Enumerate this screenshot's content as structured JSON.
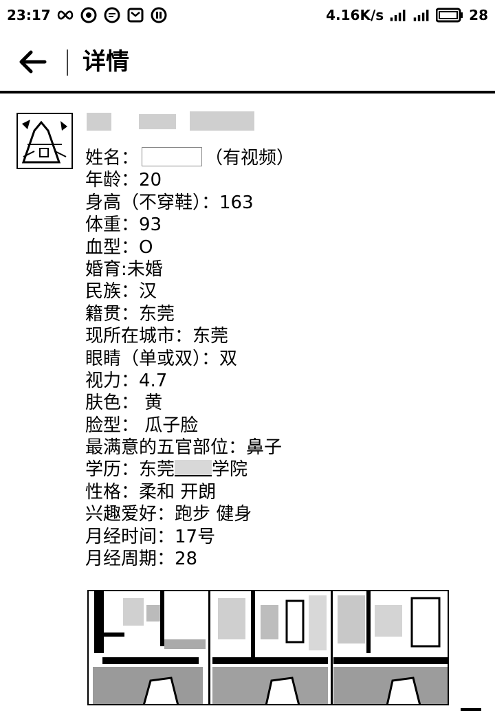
{
  "status_bar": {
    "time": "23:17",
    "network_speed": "4.16K/s",
    "battery": "28",
    "icons": [
      "infinity-icon",
      "sync-icon",
      "chat-icon",
      "mail-icon",
      "pause-icon",
      "hd-signal-icon",
      "signal-icon",
      "battery-icon"
    ]
  },
  "header": {
    "title": "详情",
    "back_icon": "arrow-left-icon"
  },
  "profile": {
    "lines": [
      {
        "label": "姓名：",
        "value": "（有视频）"
      },
      {
        "text": "年龄：20"
      },
      {
        "text": "身高（不穿鞋）：163"
      },
      {
        "text": "体重：93"
      },
      {
        "text": "血型：O"
      },
      {
        "text": "婚育:未婚"
      },
      {
        "text": "民族：汉"
      },
      {
        "text": "籍贯：东莞"
      },
      {
        "text": "现所在城市：东莞"
      },
      {
        "text": "眼睛（单或双）：双"
      },
      {
        "text": "视力：4.7"
      },
      {
        "text": "肤色： 黄"
      },
      {
        "text": "脸型： 瓜子脸"
      },
      {
        "text": "最满意的五官部位：鼻子"
      },
      {
        "prefix": "学历：东莞",
        "suffix": "学院"
      },
      {
        "text": "性格：柔和 开朗"
      },
      {
        "text": "兴趣爱好：跑步 健身"
      },
      {
        "text": "月经时间：17号"
      },
      {
        "text": "月经周期：28"
      }
    ]
  },
  "colors": {
    "text": "#000000",
    "background": "#ffffff",
    "blur": "#cfcfcf"
  }
}
